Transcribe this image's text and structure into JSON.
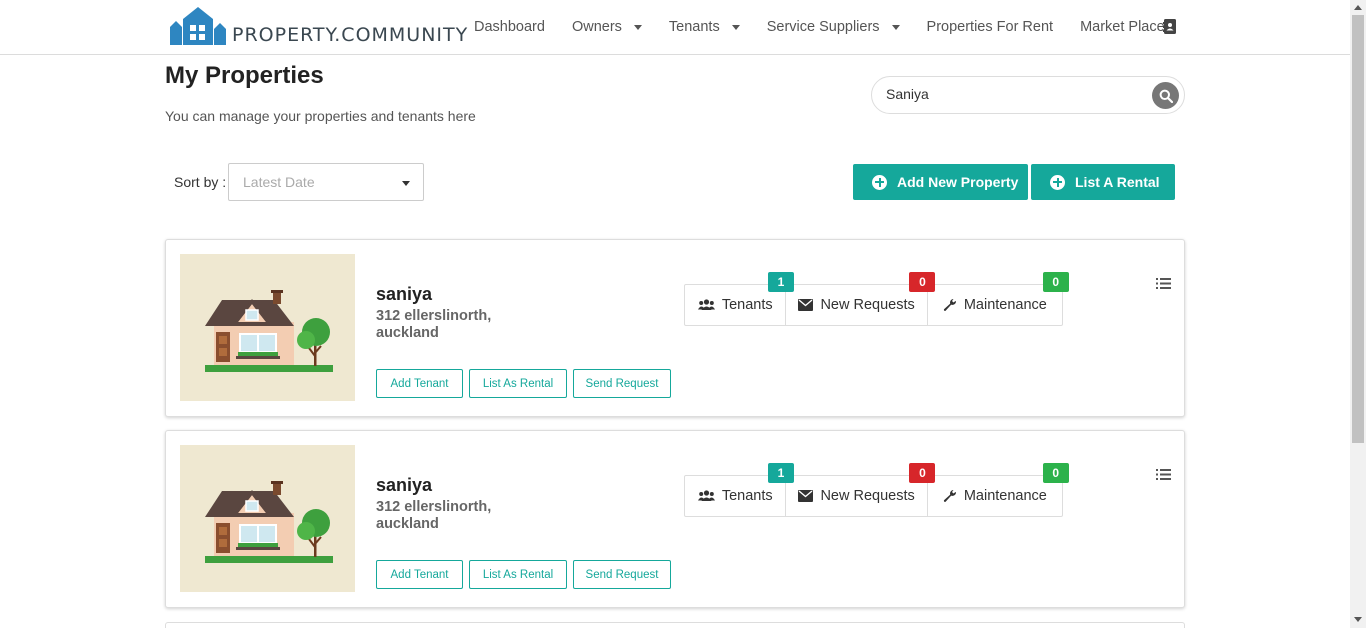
{
  "brand": {
    "name": "PROPERTY.COMMUNITY"
  },
  "nav": {
    "items": [
      {
        "label": "Dashboard",
        "dropdown": false
      },
      {
        "label": "Owners",
        "dropdown": true
      },
      {
        "label": "Tenants",
        "dropdown": true
      },
      {
        "label": "Service Suppliers",
        "dropdown": true
      },
      {
        "label": "Properties For Rent",
        "dropdown": false
      },
      {
        "label": "Market Place",
        "dropdown": false
      }
    ],
    "contact_icon": "contact-book-icon"
  },
  "header": {
    "title": "My Properties",
    "subtitle": "You can manage your properties and tenants here"
  },
  "search": {
    "value": "Saniya",
    "icon": "search-icon"
  },
  "sort": {
    "label": "Sort by :",
    "placeholder": "Latest Date"
  },
  "actions": {
    "add_property": "Add New Property",
    "list_rental": "List A Rental"
  },
  "colors": {
    "accent": "#15a89b",
    "badge_red": "#d7262a",
    "badge_green": "#2cb24b",
    "image_bg": "#efe8d1"
  },
  "properties": [
    {
      "name": "saniya",
      "address": "312 ellerslinorth, auckland",
      "buttons": [
        "Add Tenant",
        "List As Rental",
        "Send Request"
      ],
      "stats": [
        {
          "label": "Tenants",
          "count": "1",
          "icon": "users-icon"
        },
        {
          "label": "New Requests",
          "count": "0",
          "icon": "envelope-icon"
        },
        {
          "label": "Maintenance",
          "count": "0",
          "icon": "wrench-icon"
        }
      ]
    },
    {
      "name": "saniya",
      "address": "312 ellerslinorth, auckland",
      "buttons": [
        "Add Tenant",
        "List As Rental",
        "Send Request"
      ],
      "stats": [
        {
          "label": "Tenants",
          "count": "1",
          "icon": "users-icon"
        },
        {
          "label": "New Requests",
          "count": "0",
          "icon": "envelope-icon"
        },
        {
          "label": "Maintenance",
          "count": "0",
          "icon": "wrench-icon"
        }
      ]
    }
  ]
}
